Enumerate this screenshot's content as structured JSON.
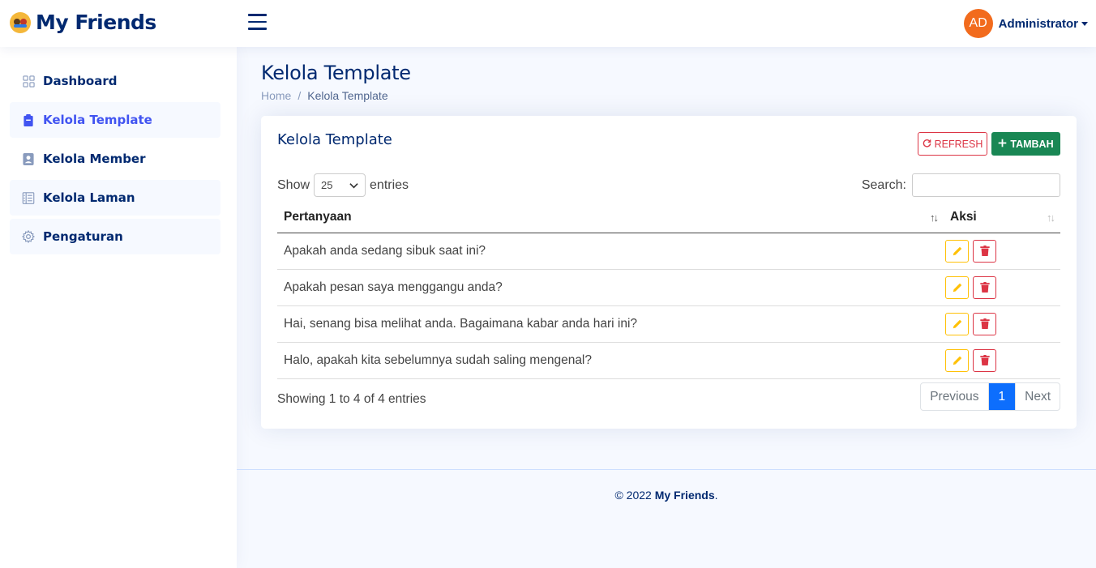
{
  "header": {
    "logo_text": "My Friends",
    "user_initials": "AD",
    "user_name": "Administrator"
  },
  "sidebar": {
    "items": [
      {
        "label": "Dashboard",
        "icon": "grid-icon"
      },
      {
        "label": "Kelola Template",
        "icon": "clipboard-icon"
      },
      {
        "label": "Kelola Member",
        "icon": "person-badge-icon"
      },
      {
        "label": "Kelola Laman",
        "icon": "layout-text-icon"
      },
      {
        "label": "Pengaturan",
        "icon": "gear-icon"
      }
    ]
  },
  "page": {
    "title": "Kelola Template",
    "breadcrumb": [
      "Home",
      "Kelola Template"
    ]
  },
  "card": {
    "title": "Kelola Template",
    "refresh_label": "REFRESH",
    "add_label": "TAMBAH",
    "show_label": "Show",
    "entries_label": "entries",
    "page_size": "25",
    "search_label": "Search:",
    "search_value": ""
  },
  "table": {
    "columns": [
      "Pertanyaan",
      "Aksi"
    ],
    "rows": [
      "Apakah anda sedang sibuk saat ini?",
      "Apakah pesan saya menggangu anda?",
      "Hai, senang bisa melihat anda. Bagaimana kabar anda hari ini?",
      "Halo, apakah kita sebelumnya sudah saling mengenal?"
    ]
  },
  "pagination": {
    "info": "Showing 1 to 4 of 4 entries",
    "previous": "Previous",
    "current": "1",
    "next": "Next"
  },
  "footer": {
    "prefix": "© 2022 ",
    "brand": "My Friends",
    "suffix": "."
  },
  "colors": {
    "brand": "#012970",
    "accent": "#4154f1",
    "danger": "#dc3545",
    "success": "#198754",
    "warning": "#ffc107",
    "primary": "#0d6efd",
    "avatar": "#f26b1d"
  }
}
